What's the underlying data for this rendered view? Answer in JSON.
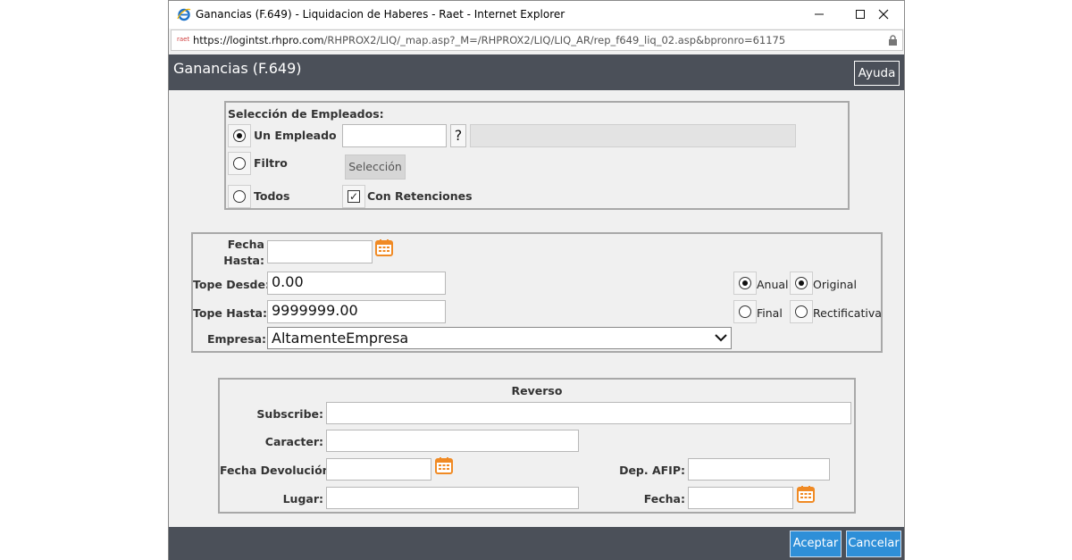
{
  "window": {
    "title": "Ganancias (F.649) - Liquidacion de Haberes - Raet - Internet Explorer",
    "url_host": "https://logintst.rhpro.com",
    "url_path": "/RHPROX2/LIQ/_map.asp?_M=/RHPROX2/LIQ/LIQ_AR/rep_f649_liq_02.asp&bpronro=61175",
    "favicon_text": "raet"
  },
  "header": {
    "title": "Ganancias (F.649)",
    "help_label": "Ayuda"
  },
  "empleados": {
    "section_label": "Selección de Empleados:",
    "un_empleado_label": "Un Empleado",
    "filtro_label": "Filtro",
    "todos_label": "Todos",
    "question_label": "?",
    "seleccion_button": "Selección",
    "con_retenciones_label": "Con Retenciones",
    "selected_option": "un_empleado",
    "con_retenciones_checked": true,
    "check_glyph": "✓"
  },
  "parametros": {
    "fecha_hasta_label_1": "Fecha",
    "fecha_hasta_label_2": "Hasta:",
    "tope_desde_label": "Tope Desde:",
    "tope_desde_value": "0.00",
    "tope_hasta_label": "Tope Hasta:",
    "tope_hasta_value": "9999999.00",
    "empresa_label": "Empresa:",
    "empresa_value": "AltamenteEmpresa",
    "anual_label": "Anual",
    "final_label": "Final",
    "original_label": "Original",
    "rectificativa_label": "Rectificativa",
    "periodo_selected": "anual",
    "tipo_selected": "original"
  },
  "reverso": {
    "title": "Reverso",
    "subscribe_label": "Subscribe:",
    "caracter_label": "Caracter:",
    "fecha_devolucion_label": "Fecha Devolución:",
    "lugar_label": "Lugar:",
    "dep_afip_label": "Dep. AFIP:",
    "fecha_label": "Fecha:"
  },
  "footer": {
    "accept_label": "Aceptar",
    "cancel_label": "Cancelar"
  },
  "colors": {
    "header_bg": "#4b5059",
    "button_blue": "#2e8fd8",
    "calendar_orange": "#f08a24",
    "ie_blue": "#1e73c8"
  }
}
